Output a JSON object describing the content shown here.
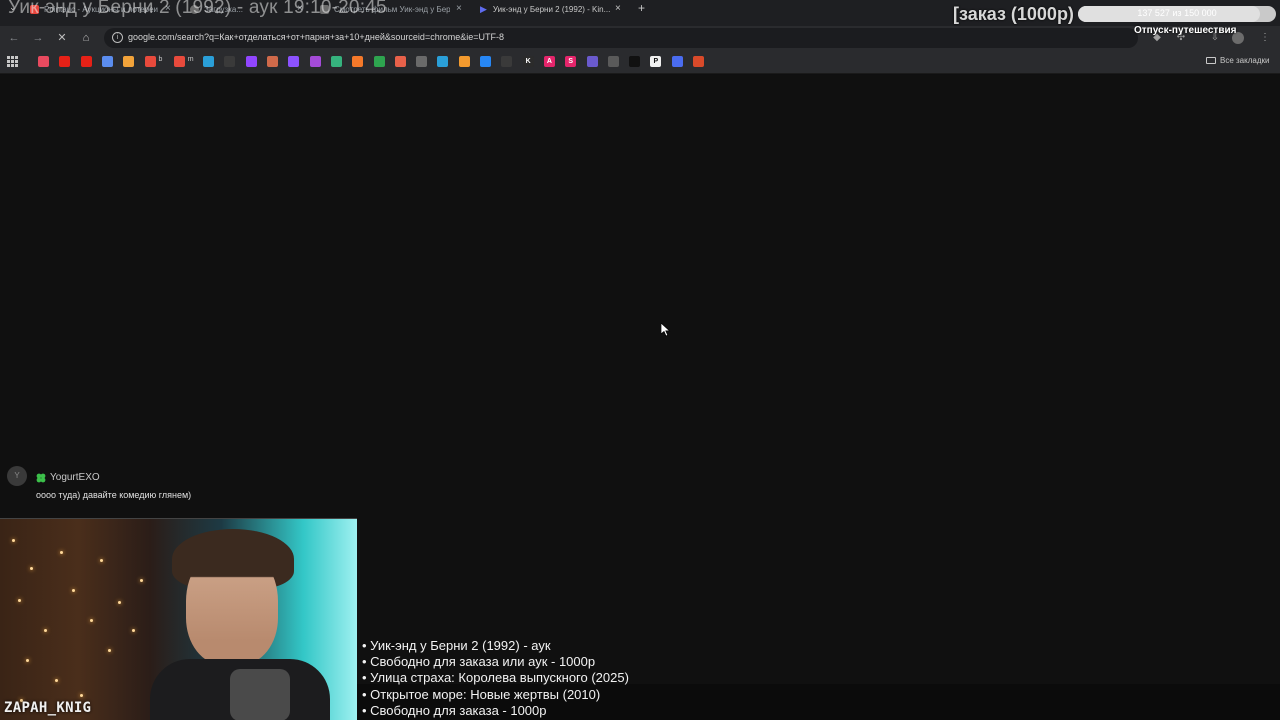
{
  "stream": {
    "title_overlay": "Уик-энд у Берни 2 (1992) - аук 19:10-20:45",
    "order_label": "[заказ (1000р)",
    "goal": {
      "progress_text": "137 527 из 150 000",
      "progress_fraction": 0.917,
      "name": "Отпуск-путешествия"
    },
    "streamer_name": "ZAPAH_KNIG"
  },
  "browser": {
    "tabs": [
      {
        "label": "Pointauc - Аукционы и лотереи",
        "color": "#e8453c"
      },
      {
        "label": "Загрузка...",
        "color": "#6b6b6b"
      },
      {
        "label": "Смотреть фильм Уик-энд у Бер...",
        "color": "#6b6b6b"
      },
      {
        "label": "Уик-энд у Берни 2 (1992) - Kin...",
        "color": "#5f6cf0"
      }
    ],
    "url": "google.com/search?q=Как+отделаться+от+парня+за+10+дней&sourceid=chrome&ie=UTF-8",
    "all_bookmarks_label": "Все закладки",
    "bookmarks": [
      {
        "icon": "mail-icon",
        "color": "#e84a5f",
        "text": ""
      },
      {
        "icon": "youtube-icon",
        "color": "#e62117",
        "text": ""
      },
      {
        "icon": "youtube-music-icon",
        "color": "#e62117",
        "text": ""
      },
      {
        "icon": "app-icon",
        "color": "#5b8def",
        "text": ""
      },
      {
        "icon": "envelope-icon",
        "color": "#f2a33a",
        "text": ""
      },
      {
        "icon": "gmail-icon",
        "color": "#e84a3c",
        "text": "b"
      },
      {
        "icon": "gmail-icon",
        "color": "#e84a3c",
        "text": "m"
      },
      {
        "icon": "edge-icon",
        "color": "#2a9fd8",
        "text": ""
      },
      {
        "icon": "star-icon",
        "color": "#3a3a3a",
        "text": ""
      },
      {
        "icon": "twitch-icon",
        "color": "#9146ff",
        "text": ""
      },
      {
        "icon": "feather-icon",
        "color": "#d06a4a",
        "text": ""
      },
      {
        "icon": "circle-icon",
        "color": "#8c52ff",
        "text": ""
      },
      {
        "icon": "blog-icon",
        "color": "#a44bd8",
        "text": ""
      },
      {
        "icon": "puzzle-icon",
        "color": "#36b37e",
        "text": ""
      },
      {
        "icon": "boosty-icon",
        "color": "#f5792a",
        "text": ""
      },
      {
        "icon": "sheets-icon",
        "color": "#2ea44f",
        "text": ""
      },
      {
        "icon": "donation-icon",
        "color": "#e8614a",
        "text": ""
      },
      {
        "icon": "calendar-icon",
        "color": "#6a6a6a",
        "text": ""
      },
      {
        "icon": "chat-icon",
        "color": "#2a9fd8",
        "text": ""
      },
      {
        "icon": "odnoklassniki-icon",
        "color": "#f39a2e",
        "text": ""
      },
      {
        "icon": "vk-icon",
        "color": "#2787f5",
        "text": ""
      },
      {
        "icon": "vk-play-icon",
        "color": "#3a3a3a",
        "text": ""
      },
      {
        "icon": "k-icon",
        "color": "#2b2b2b",
        "text": "K"
      },
      {
        "icon": "a-icon",
        "color": "#e5256b",
        "text": "A"
      },
      {
        "icon": "s-icon",
        "color": "#e5256b",
        "text": "S"
      },
      {
        "icon": "shield-icon",
        "color": "#6a5acd",
        "text": ""
      },
      {
        "icon": "globe-icon",
        "color": "#5a5a5a",
        "text": ""
      },
      {
        "icon": "play-icon",
        "color": "#111111",
        "text": ""
      },
      {
        "icon": "p-icon",
        "color": "#f0f0f0",
        "text": "P"
      },
      {
        "icon": "c-icon",
        "color": "#4a6cf0",
        "text": ""
      },
      {
        "icon": "square-icon",
        "color": "#d94a2a",
        "text": ""
      }
    ]
  },
  "chat": {
    "username": "YogurtEXO",
    "avatar_letter": "Y",
    "message": "оооо туда) давайте комедию глянем)"
  },
  "queue": [
    "• Уик-энд у Берни 2 (1992) - аук",
    "• Свободно для заказа или аук - 1000р",
    "• Улица страха: Королева выпускного (2025)",
    "• Открытое море: Новые жертвы (2010)",
    "• Свободно для заказа - 1000р"
  ]
}
